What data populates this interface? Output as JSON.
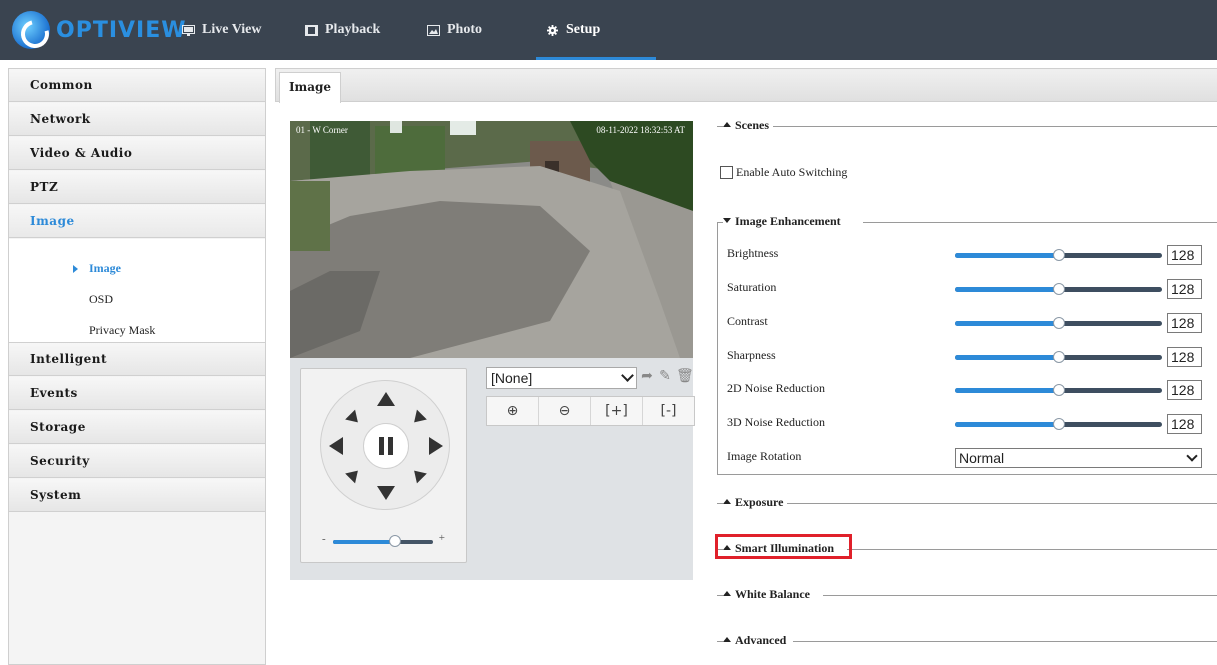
{
  "brand": {
    "name": "OPTIVIEW"
  },
  "nav": {
    "items": [
      {
        "label": "Live View",
        "icon": "monitor-icon"
      },
      {
        "label": "Playback",
        "icon": "film-icon"
      },
      {
        "label": "Photo",
        "icon": "picture-icon"
      },
      {
        "label": "Setup",
        "icon": "gear-icon",
        "active": true
      }
    ]
  },
  "sidebar": {
    "items": [
      {
        "label": "Common"
      },
      {
        "label": "Network"
      },
      {
        "label": "Video & Audio"
      },
      {
        "label": "PTZ"
      },
      {
        "label": "Image",
        "active": true
      }
    ],
    "submenu": [
      {
        "label": "Image",
        "active": true
      },
      {
        "label": "OSD"
      },
      {
        "label": "Privacy Mask"
      }
    ],
    "items_after": [
      {
        "label": "Intelligent"
      },
      {
        "label": "Events"
      },
      {
        "label": "Storage"
      },
      {
        "label": "Security"
      },
      {
        "label": "System"
      }
    ]
  },
  "tab": {
    "label": "Image"
  },
  "preview": {
    "osd_left": "01 - W Corner",
    "osd_right": "08-11-2022 18:32:53 AT"
  },
  "ptz": {
    "preset_value": "[None]",
    "zoom_level": 0.62,
    "zoom_minus": "-",
    "zoom_plus": "+"
  },
  "sections": {
    "scenes": "Scenes",
    "enable_auto_switching": "Enable Auto Switching",
    "image_enhancement": "Image Enhancement",
    "exposure": "Exposure",
    "smart_illumination": "Smart Illumination",
    "white_balance": "White Balance",
    "advanced": "Advanced"
  },
  "params": [
    {
      "label": "Brightness",
      "value": "128",
      "level": 0.5
    },
    {
      "label": "Saturation",
      "value": "128",
      "level": 0.5
    },
    {
      "label": "Contrast",
      "value": "128",
      "level": 0.5
    },
    {
      "label": "Sharpness",
      "value": "128",
      "level": 0.5
    },
    {
      "label": "2D Noise Reduction",
      "value": "128",
      "level": 0.5
    },
    {
      "label": "3D Noise Reduction",
      "value": "128",
      "level": 0.5
    }
  ],
  "rotation": {
    "label": "Image Rotation",
    "value": "Normal"
  },
  "colors": {
    "accent": "#2d8ad8",
    "topbar": "#3a4450",
    "highlight": "#e0202a"
  }
}
